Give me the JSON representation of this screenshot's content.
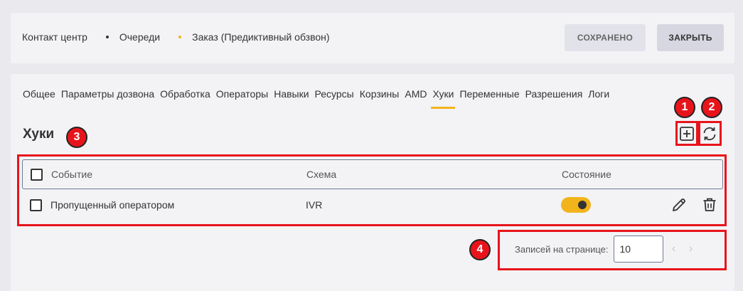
{
  "breadcrumb": {
    "items": [
      "Контакт центр",
      "Очереди",
      "Заказ (Предиктивный обзвон)"
    ]
  },
  "toolbar": {
    "saved_label": "СОХРАНЕНО",
    "close_label": "ЗАКРЫТЬ"
  },
  "tabs": {
    "items": [
      "Общее",
      "Параметры дозвона",
      "Обработка",
      "Операторы",
      "Навыки",
      "Ресурсы",
      "Корзины",
      "AMD",
      "Хуки",
      "Переменные",
      "Разрешения",
      "Логи"
    ],
    "active": "Хуки"
  },
  "section": {
    "title": "Хуки",
    "add_icon": "plus-square-icon",
    "refresh_icon": "refresh-icon"
  },
  "table": {
    "columns": [
      "Событие",
      "Схема",
      "Состояние"
    ],
    "rows": [
      {
        "event": "Пропущенный оператором",
        "scheme": "IVR",
        "enabled": true
      }
    ]
  },
  "pagination": {
    "label": "Записей на странице:",
    "page_size": "10",
    "prev_icon": "chevron-left-icon",
    "next_icon": "chevron-right-icon"
  },
  "annotations": {
    "badges": [
      "1",
      "2",
      "3",
      "4"
    ],
    "color": "#e8141b"
  },
  "colors": {
    "accent": "#f2b41b",
    "panel": "#f3f3f6",
    "background": "#e9e9ee"
  }
}
